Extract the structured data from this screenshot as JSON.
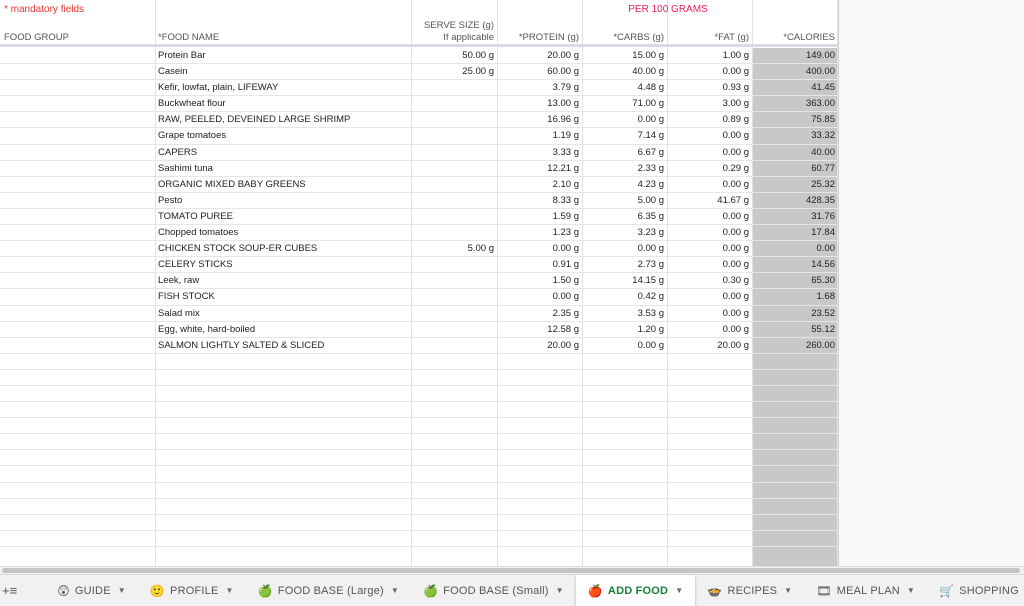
{
  "header": {
    "mandatory_note": "* mandatory fields",
    "per100": "PER 100 GRAMS",
    "col_group": "FOOD GROUP",
    "col_name": "*FOOD NAME",
    "col_serve_1": "SERVE SIZE (g)",
    "col_serve_2": "If applicable",
    "col_protein": "*PROTEIN (g)",
    "col_carbs": "*CARBS (g)",
    "col_fat": "*FAT (g)",
    "col_calories": "*CALORIES"
  },
  "rows": [
    {
      "name": "Protein Bar",
      "serve": "50.00 g",
      "protein": "20.00 g",
      "carbs": "15.00 g",
      "fat": "1.00 g",
      "calories": "149.00"
    },
    {
      "name": "Casein",
      "serve": "25.00 g",
      "protein": "60.00 g",
      "carbs": "40.00 g",
      "fat": "0.00 g",
      "calories": "400.00"
    },
    {
      "name": "Kefir, lowfat, plain, LIFEWAY",
      "serve": "",
      "protein": "3.79 g",
      "carbs": "4.48 g",
      "fat": "0.93 g",
      "calories": "41.45"
    },
    {
      "name": "Buckwheat flour",
      "serve": "",
      "protein": "13.00 g",
      "carbs": "71.00 g",
      "fat": "3.00 g",
      "calories": "363.00"
    },
    {
      "name": "RAW, PEELED, DEVEINED LARGE SHRIMP",
      "serve": "",
      "protein": "16.96 g",
      "carbs": "0.00 g",
      "fat": "0.89 g",
      "calories": "75.85"
    },
    {
      "name": "Grape tomatoes",
      "serve": "",
      "protein": "1.19 g",
      "carbs": "7.14 g",
      "fat": "0.00 g",
      "calories": "33.32"
    },
    {
      "name": "CAPERS",
      "serve": "",
      "protein": "3.33 g",
      "carbs": "6.67 g",
      "fat": "0.00 g",
      "calories": "40.00"
    },
    {
      "name": "Sashimi tuna",
      "serve": "",
      "protein": "12.21 g",
      "carbs": "2.33 g",
      "fat": "0.29 g",
      "calories": "60.77"
    },
    {
      "name": "ORGANIC MIXED BABY GREENS",
      "serve": "",
      "protein": "2.10 g",
      "carbs": "4.23 g",
      "fat": "0.00 g",
      "calories": "25.32"
    },
    {
      "name": "Pesto",
      "serve": "",
      "protein": "8.33 g",
      "carbs": "5.00 g",
      "fat": "41.67 g",
      "calories": "428.35"
    },
    {
      "name": "TOMATO PUREE",
      "serve": "",
      "protein": "1.59 g",
      "carbs": "6.35 g",
      "fat": "0.00 g",
      "calories": "31.76"
    },
    {
      "name": "Chopped tomatoes",
      "serve": "",
      "protein": "1.23 g",
      "carbs": "3.23 g",
      "fat": "0.00 g",
      "calories": "17.84"
    },
    {
      "name": "CHICKEN STOCK SOUP-ER CUBES",
      "serve": "5.00 g",
      "protein": "0.00 g",
      "carbs": "0.00 g",
      "fat": "0.00 g",
      "calories": "0.00"
    },
    {
      "name": "CELERY STICKS",
      "serve": "",
      "protein": "0.91 g",
      "carbs": "2.73 g",
      "fat": "0.00 g",
      "calories": "14.56"
    },
    {
      "name": "Leek, raw",
      "serve": "",
      "protein": "1.50 g",
      "carbs": "14.15 g",
      "fat": "0.30 g",
      "calories": "65.30"
    },
    {
      "name": "FISH STOCK",
      "serve": "",
      "protein": "0.00 g",
      "carbs": "0.42 g",
      "fat": "0.00 g",
      "calories": "1.68"
    },
    {
      "name": "Salad mix",
      "serve": "",
      "protein": "2.35 g",
      "carbs": "3.53 g",
      "fat": "0.00 g",
      "calories": "23.52"
    },
    {
      "name": "Egg, white, hard-boiled",
      "serve": "",
      "protein": "12.58 g",
      "carbs": "1.20 g",
      "fat": "0.00 g",
      "calories": "55.12"
    },
    {
      "name": "SALMON LIGHTLY SALTED & SLICED",
      "serve": "",
      "protein": "20.00 g",
      "carbs": "0.00 g",
      "fat": "20.00 g",
      "calories": "260.00"
    },
    {
      "name": "",
      "serve": "",
      "protein": "",
      "carbs": "",
      "fat": "",
      "calories": ""
    },
    {
      "name": "",
      "serve": "",
      "protein": "",
      "carbs": "",
      "fat": "",
      "calories": ""
    },
    {
      "name": "",
      "serve": "",
      "protein": "",
      "carbs": "",
      "fat": "",
      "calories": ""
    },
    {
      "name": "",
      "serve": "",
      "protein": "",
      "carbs": "",
      "fat": "",
      "calories": ""
    },
    {
      "name": "",
      "serve": "",
      "protein": "",
      "carbs": "",
      "fat": "",
      "calories": ""
    },
    {
      "name": "",
      "serve": "",
      "protein": "",
      "carbs": "",
      "fat": "",
      "calories": ""
    },
    {
      "name": "",
      "serve": "",
      "protein": "",
      "carbs": "",
      "fat": "",
      "calories": ""
    },
    {
      "name": "",
      "serve": "",
      "protein": "",
      "carbs": "",
      "fat": "",
      "calories": ""
    },
    {
      "name": "",
      "serve": "",
      "protein": "",
      "carbs": "",
      "fat": "",
      "calories": ""
    },
    {
      "name": "",
      "serve": "",
      "protein": "",
      "carbs": "",
      "fat": "",
      "calories": ""
    },
    {
      "name": "",
      "serve": "",
      "protein": "",
      "carbs": "",
      "fat": "",
      "calories": ""
    },
    {
      "name": "",
      "serve": "",
      "protein": "",
      "carbs": "",
      "fat": "",
      "calories": ""
    }
  ],
  "tabs": [
    {
      "label": "GUIDE",
      "icon": "😲",
      "icon_name": "face-icon",
      "active": false
    },
    {
      "label": "PROFILE",
      "icon": "🙂",
      "icon_name": "smiley-icon",
      "active": false
    },
    {
      "label": "FOOD BASE (Large)",
      "icon": "🍏",
      "icon_name": "green-apple-icon",
      "active": false
    },
    {
      "label": "FOOD BASE (Small)",
      "icon": "🍏",
      "icon_name": "green-apple-icon",
      "active": false
    },
    {
      "label": "ADD FOOD",
      "icon": "🍎",
      "icon_name": "red-apple-icon",
      "active": true
    },
    {
      "label": "RECIPES",
      "icon": "🍲",
      "icon_name": "bowl-icon",
      "active": false
    },
    {
      "label": "MEAL PLAN",
      "icon": "🎞",
      "icon_name": "film-icon",
      "active": false
    },
    {
      "label": "SHOPPING",
      "icon": "🛒",
      "icon_name": "cart-icon",
      "active": false
    }
  ],
  "colors": {
    "mandatory": "#e53935",
    "per100": "#e91e63",
    "active_tab": "#188038",
    "calories_bg": "#c8c8c8"
  }
}
